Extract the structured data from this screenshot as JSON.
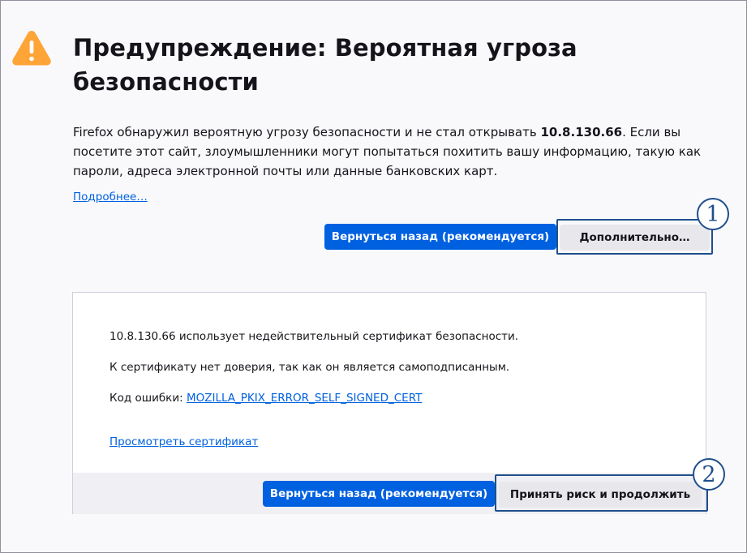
{
  "page": {
    "title": "Предупреждение: Вероятная угроза безопасности",
    "intro_prefix": "Firefox обнаружил вероятную угрозу безопасности и не стал открывать ",
    "host": "10.8.130.66",
    "intro_suffix": ". Если вы посетите этот сайт, злоумышленники могут попытаться похитить вашу информацию, такую как пароли, адреса электронной почты или данные банковских карт.",
    "learn_more": "Подробнее…"
  },
  "buttons": {
    "go_back": "Вернуться назад (рекомендуется)",
    "advanced": "Дополнительно…"
  },
  "advanced_panel": {
    "line1": "10.8.130.66 использует недействительный сертификат безопасности.",
    "line2": "К сертификату нет доверия, так как он является самоподписанным.",
    "error_code_label": "Код ошибки: ",
    "error_code": "MOZILLA_PKIX_ERROR_SELF_SIGNED_CERT",
    "view_certificate": "Просмотреть сертификат",
    "go_back": "Вернуться назад (рекомендуется)",
    "accept_risk": "Принять риск и продолжить"
  },
  "callouts": {
    "one": "1",
    "two": "2"
  },
  "colors": {
    "primary_button": "#0061e0",
    "secondary_button": "#e8e8ec",
    "link": "#0061e0",
    "warning_icon": "#ffa436",
    "callout": "#1f4f8c"
  },
  "icons": {
    "warning": "warning-icon"
  }
}
